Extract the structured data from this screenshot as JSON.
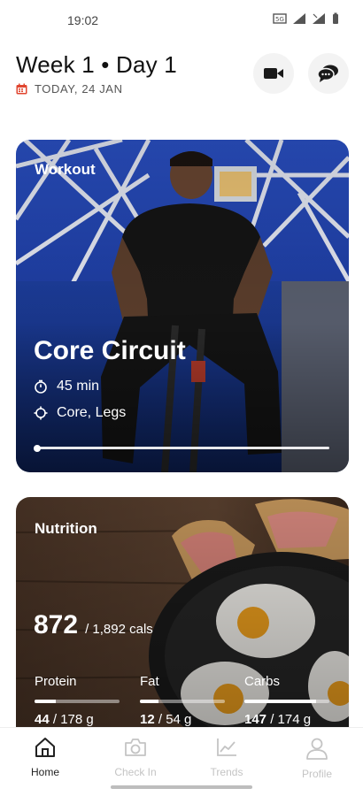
{
  "status": {
    "time": "19:02"
  },
  "header": {
    "title": "Week 1 • Day 1",
    "date": "TODAY, 24 JAN"
  },
  "workout": {
    "label": "Workout",
    "title": "Core Circuit",
    "duration": "45 min",
    "focus": "Core, Legs",
    "progress": 0
  },
  "nutrition": {
    "label": "Nutrition",
    "calories_consumed": "872",
    "calories_goal": "/ 1,892 cals",
    "macros": [
      {
        "label": "Protein",
        "current": "44",
        "goal": "/ 178 g",
        "fraction": 0.25
      },
      {
        "label": "Fat",
        "current": "12",
        "goal": "/ 54 g",
        "fraction": 0.22
      },
      {
        "label": "Carbs",
        "current": "147",
        "goal": "/ 174 g",
        "fraction": 0.84
      }
    ]
  },
  "tabs": [
    {
      "label": "Home",
      "icon": "home-icon",
      "active": true
    },
    {
      "label": "Check In",
      "icon": "camera-icon",
      "active": false
    },
    {
      "label": "Trends",
      "icon": "chart-icon",
      "active": false
    },
    {
      "label": "Profile",
      "icon": "profile-icon",
      "active": false
    }
  ],
  "colors": {
    "accent_red": "#e0452f",
    "tab_active": "#222222",
    "tab_inactive": "#c4c4c4"
  }
}
